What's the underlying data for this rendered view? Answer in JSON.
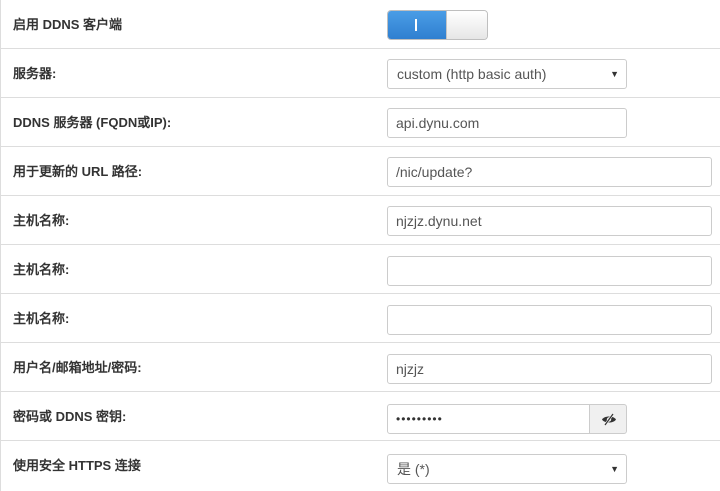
{
  "rows": [
    {
      "label": "启用 DDNS 客户端"
    },
    {
      "label": "服务器:",
      "value": "custom (http basic auth)"
    },
    {
      "label": "DDNS 服务器 (FQDN或IP):",
      "value": "api.dynu.com"
    },
    {
      "label": "用于更新的 URL 路径:",
      "value": "/nic/update?"
    },
    {
      "label": "主机名称:",
      "value": "njzjz.dynu.net"
    },
    {
      "label": "主机名称:",
      "value": ""
    },
    {
      "label": "主机名称:",
      "value": ""
    },
    {
      "label": "用户名/邮箱地址/密码:",
      "value": "njzjz"
    },
    {
      "label": "密码或 DDNS 密钥:",
      "value": "•••••••••"
    },
    {
      "label": "使用安全 HTTPS 连接",
      "value": "是 (*)"
    }
  ],
  "ddns_enabled": true,
  "colors": {
    "toggle_on": "#3b8ddb",
    "border": "#dddddd"
  },
  "icons": {
    "dropdown": "caret-down-icon",
    "show_password": "eye-slash-icon"
  }
}
